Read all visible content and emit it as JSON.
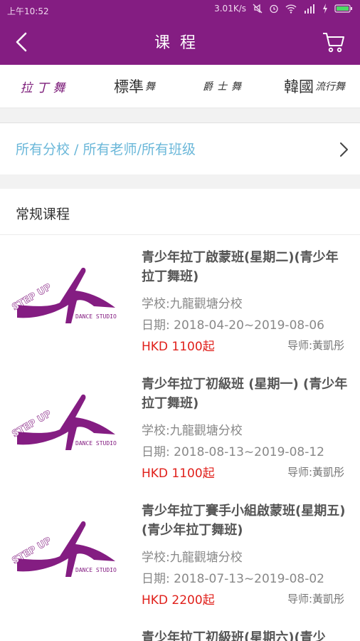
{
  "status": {
    "time": "上午10:52",
    "speed": "3.01K/s"
  },
  "header": {
    "title": "课程"
  },
  "tabs": [
    {
      "label": "拉丁舞"
    },
    {
      "label_main": "標準",
      "label_small": "舞"
    },
    {
      "label": "爵士舞"
    },
    {
      "label_main": "韓國",
      "label_small": "流行舞"
    }
  ],
  "filter": {
    "text": "所有分校 / 所有老师/所有班级"
  },
  "section": {
    "title": "常规课程"
  },
  "courses": [
    {
      "title": "青少年拉丁啟蒙班(星期二)(青少年拉丁舞班)",
      "school": "学校:九龍觀塘分校",
      "date": "日期: 2018-04-20~2019-08-06",
      "price": "HKD 1100起",
      "teacher": "导师:黃凱彤"
    },
    {
      "title": "青少年拉丁初級班 (星期一) (青少年拉丁舞班)",
      "school": "学校:九龍觀塘分校",
      "date": "日期: 2018-08-13~2019-08-12",
      "price": "HKD 1100起",
      "teacher": "导师:黃凱彤"
    },
    {
      "title": "青少年拉丁賽手小組啟蒙班(星期五)(青少年拉丁舞班)",
      "school": "学校:九龍觀塘分校",
      "date": "日期: 2018-07-13~2019-08-02",
      "price": "HKD 2200起",
      "teacher": "导师:黃凱彤"
    },
    {
      "title": "青少年拉丁初級班(星期六)(青少"
    }
  ],
  "logo": {
    "brand": "STEP UP",
    "subtitle": "DANCE STUDIO"
  },
  "colors": {
    "primary": "#841d82",
    "link": "#6ab7d9",
    "price": "#e0201b"
  }
}
